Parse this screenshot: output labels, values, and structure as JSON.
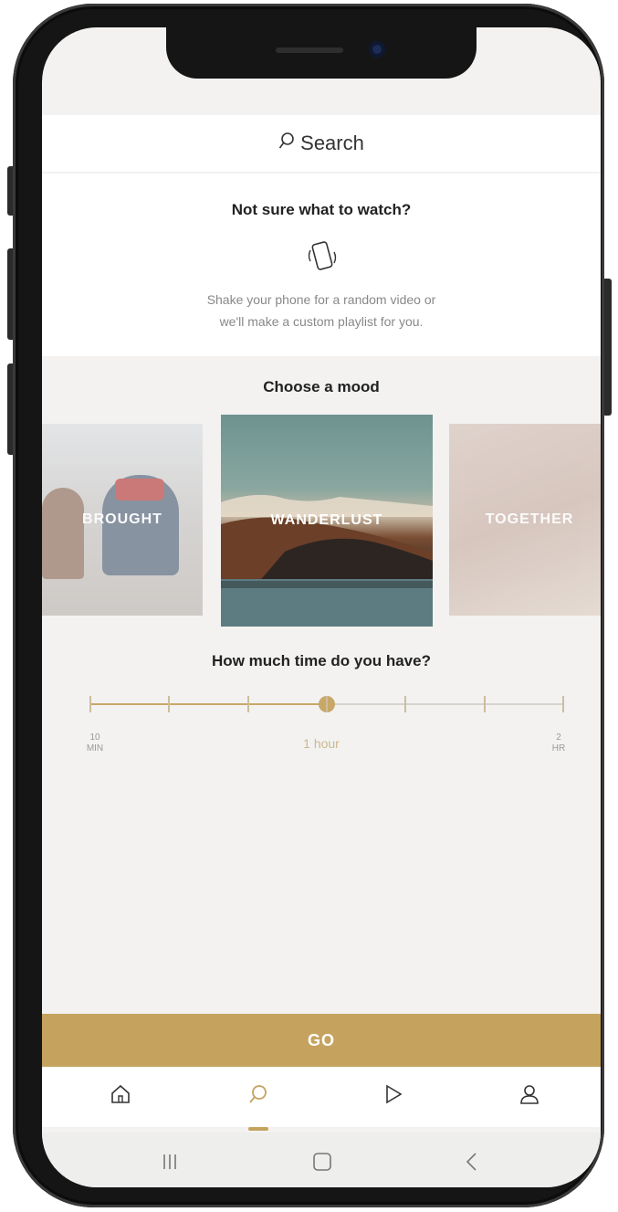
{
  "search": {
    "label": "Search",
    "icon": "search-icon"
  },
  "shake": {
    "title": "Not sure what to watch?",
    "icon": "shake-phone-icon",
    "line1": "Shake your phone for a random video or",
    "line2": "we'll make a custom playlist for you."
  },
  "mood": {
    "title": "Choose a mood",
    "cards": [
      {
        "label": "BROUGHT"
      },
      {
        "label": "WANDERLUST"
      },
      {
        "label": "TOGETHER"
      }
    ]
  },
  "time": {
    "title": "How much time do you have?",
    "min_line1": "10",
    "min_line2": "MIN",
    "max_line1": "2",
    "max_line2": "HR",
    "value": "1 hour",
    "ticks": 7,
    "selected_fraction": 0.5
  },
  "go": {
    "label": "GO"
  },
  "tabs": [
    "home-icon",
    "search-icon",
    "play-icon",
    "profile-icon"
  ],
  "system": [
    "recent-apps-icon",
    "home-square-icon",
    "back-icon"
  ],
  "colors": {
    "accent": "#c5a35f",
    "background": "#f3f2f1"
  }
}
